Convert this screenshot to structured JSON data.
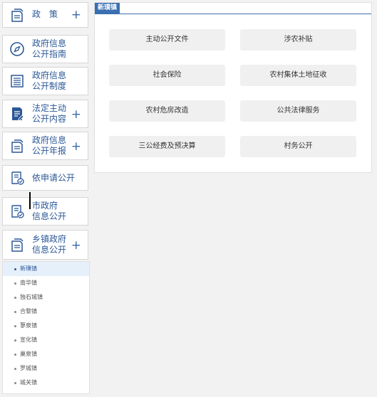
{
  "sidebar": {
    "items": [
      {
        "label": "政　策",
        "icon": "file-stack-icon",
        "expandable": true
      },
      {
        "label": "政府信息\n公开指南",
        "icon": "compass-icon",
        "expandable": false
      },
      {
        "label": "政府信息\n公开制度",
        "icon": "list-document-icon",
        "expandable": false
      },
      {
        "label": "法定主动\n公开内容",
        "icon": "edit-document-icon",
        "expandable": true
      },
      {
        "label": "政府信息\n公开年报",
        "icon": "file-stack-icon",
        "expandable": true
      },
      {
        "label": "依申请公开",
        "icon": "checked-document-icon",
        "expandable": false
      },
      {
        "label": "市政府\n信息公开",
        "icon": "checked-document-icon",
        "expandable": false
      },
      {
        "label": "乡镇政府\n信息公开",
        "icon": "file-stack-icon",
        "expandable": true
      }
    ],
    "plus_glyph": "+",
    "towns": [
      "新璞镇",
      "南华镇",
      "独石城镇",
      "合黎镇",
      "蓼泉镇",
      "宣化镇",
      "巢泉镇",
      "罗城镇",
      "城关镇"
    ],
    "active_town": "新璞镇"
  },
  "panel": {
    "tab_title": "新璞镇",
    "buttons": [
      "主动公开文件",
      "涉农补贴",
      "社会保险",
      "农村集体土地征收",
      "农村危房改造",
      "公共法律服务",
      "三公经费及预决算",
      "村务公开"
    ]
  },
  "colors": {
    "accent": "#2b5797",
    "tab_bg": "#3a6fb0",
    "button_bg": "#f0f0f0",
    "active_row_bg": "#e6f0fa"
  }
}
